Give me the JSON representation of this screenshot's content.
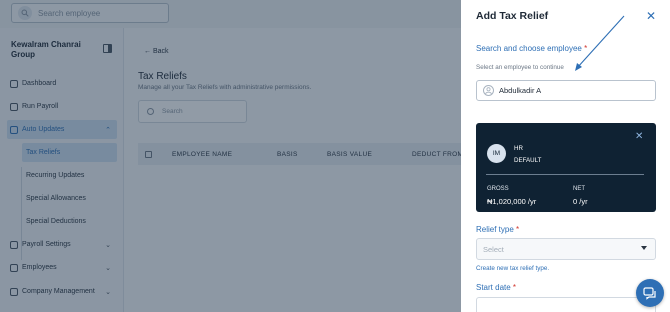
{
  "topbar": {
    "search_placeholder": "Search employee"
  },
  "sidebar": {
    "org_name": "Kewalram Chanrai Group",
    "items": [
      {
        "label": "Dashboard"
      },
      {
        "label": "Run Payroll"
      },
      {
        "label": "Auto Updates"
      },
      {
        "label": "Payroll Settings"
      },
      {
        "label": "Employees"
      },
      {
        "label": "Company Management"
      }
    ],
    "sub_items": [
      {
        "label": "Tax Reliefs"
      },
      {
        "label": "Recurring Updates"
      },
      {
        "label": "Special Allowances"
      },
      {
        "label": "Special Deductions"
      }
    ]
  },
  "main": {
    "back_label": "Back",
    "title": "Tax Reliefs",
    "subtitle": "Manage all your Tax Reliefs with administrative permissions.",
    "search_placeholder": "Search",
    "columns": [
      "EMPLOYEE NAME",
      "BASIS",
      "BASIS VALUE",
      "DEDUCT FROM S"
    ]
  },
  "drawer": {
    "title": "Add Tax Relief",
    "close_icon": "close-icon",
    "search_label": "Search and choose employee",
    "required_mark": "*",
    "search_hint": "Select an employee to continue",
    "selected_employee": "Abdulkadir A",
    "card": {
      "initials": "IM",
      "department": "HR",
      "group": "DEFAULT",
      "gross_label": "GROSS",
      "gross_value": "₦1,020,000 /yr",
      "net_label": "NET",
      "net_value": "0 /yr"
    },
    "relief_type_label": "Relief type",
    "relief_type_placeholder": "Select",
    "create_link": "Create new tax relief type.",
    "start_date_label": "Start date"
  },
  "colors": {
    "accent": "#2e6fb5",
    "card_bg": "#0f2233",
    "required": "#d0342c"
  }
}
